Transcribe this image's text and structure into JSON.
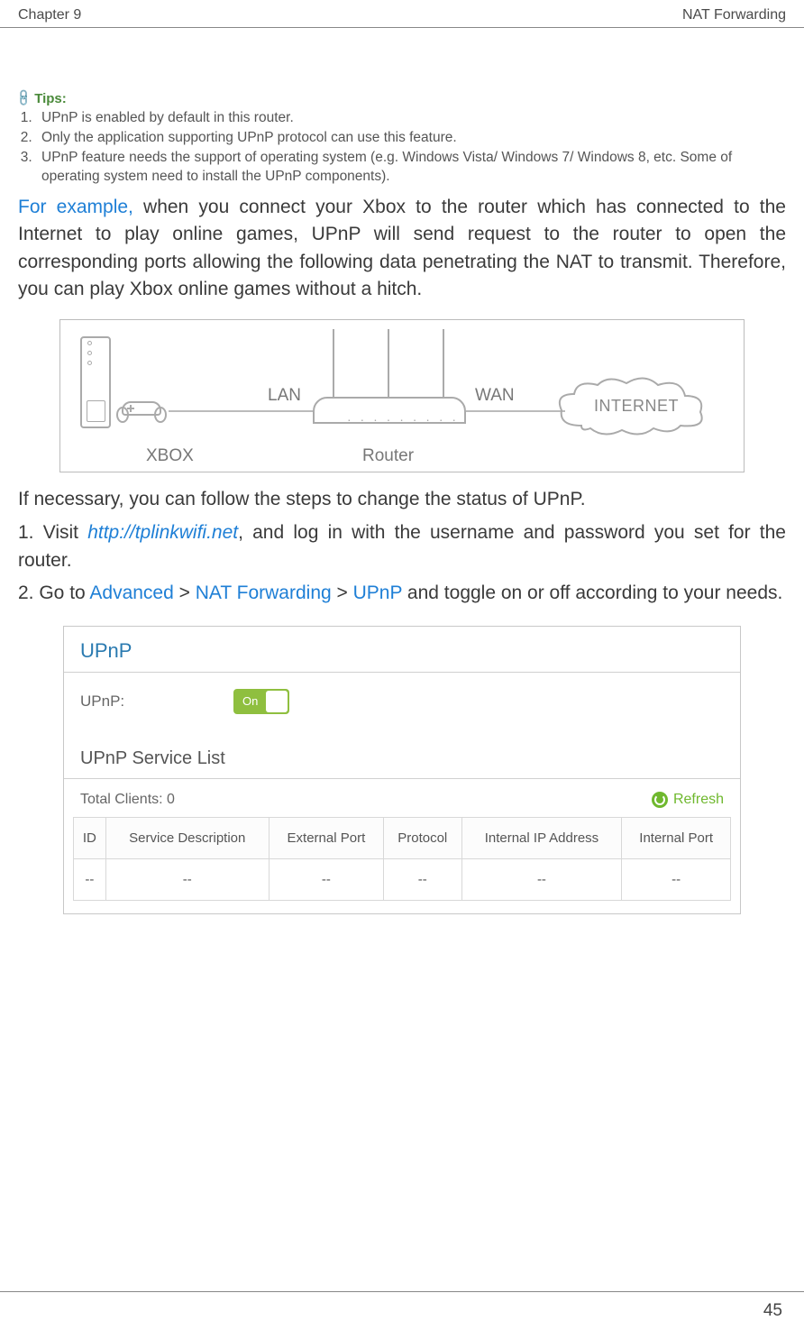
{
  "header": {
    "chapter": "Chapter 9",
    "section": "NAT Forwarding"
  },
  "tips": {
    "label": "Tips:",
    "items": [
      "UPnP is enabled by default in this router.",
      "Only the application supporting UPnP protocol can use this feature.",
      "UPnP feature needs the support of operating system (e.g. Windows Vista/ Windows 7/ Windows 8, etc. Some of operating system need to install the UPnP components)."
    ]
  },
  "example": {
    "prefix": "For example,",
    "text": " when you connect your Xbox to the router which has connected to the Internet to play online games, UPnP will send request to the router to open the corresponding ports allowing the following data penetrating the NAT to transmit. Therefore, you can play Xbox online games without a hitch."
  },
  "diagram": {
    "xbox": "XBOX",
    "lan": "LAN",
    "router": "Router",
    "wan": "WAN",
    "internet": "INTERNET"
  },
  "intro": "If necessary, you can follow the steps to change the status of UPnP.",
  "steps": {
    "one_prefix": "1. Visit ",
    "one_link": "http://tplinkwifi.net",
    "one_suffix": ", and log in with the username and password you set for the router.",
    "two_prefix": "2. Go to ",
    "two_nav1": "Advanced",
    "two_sep": " > ",
    "two_nav2": "NAT Forwarding",
    "two_nav3": "UPnP",
    "two_suffix": " and toggle on or off according to your needs."
  },
  "panel": {
    "title": "UPnP",
    "label": "UPnP:",
    "toggle": "On",
    "svc_title": "UPnP Service List",
    "total_clients_label": "Total Clients:",
    "total_clients_value": "0",
    "refresh": "Refresh",
    "cols": {
      "id": "ID",
      "desc": "Service Description",
      "ext": "External Port",
      "proto": "Protocol",
      "ip": "Internal IP Address",
      "intp": "Internal Port"
    },
    "empty": "--"
  },
  "page_number": "45"
}
